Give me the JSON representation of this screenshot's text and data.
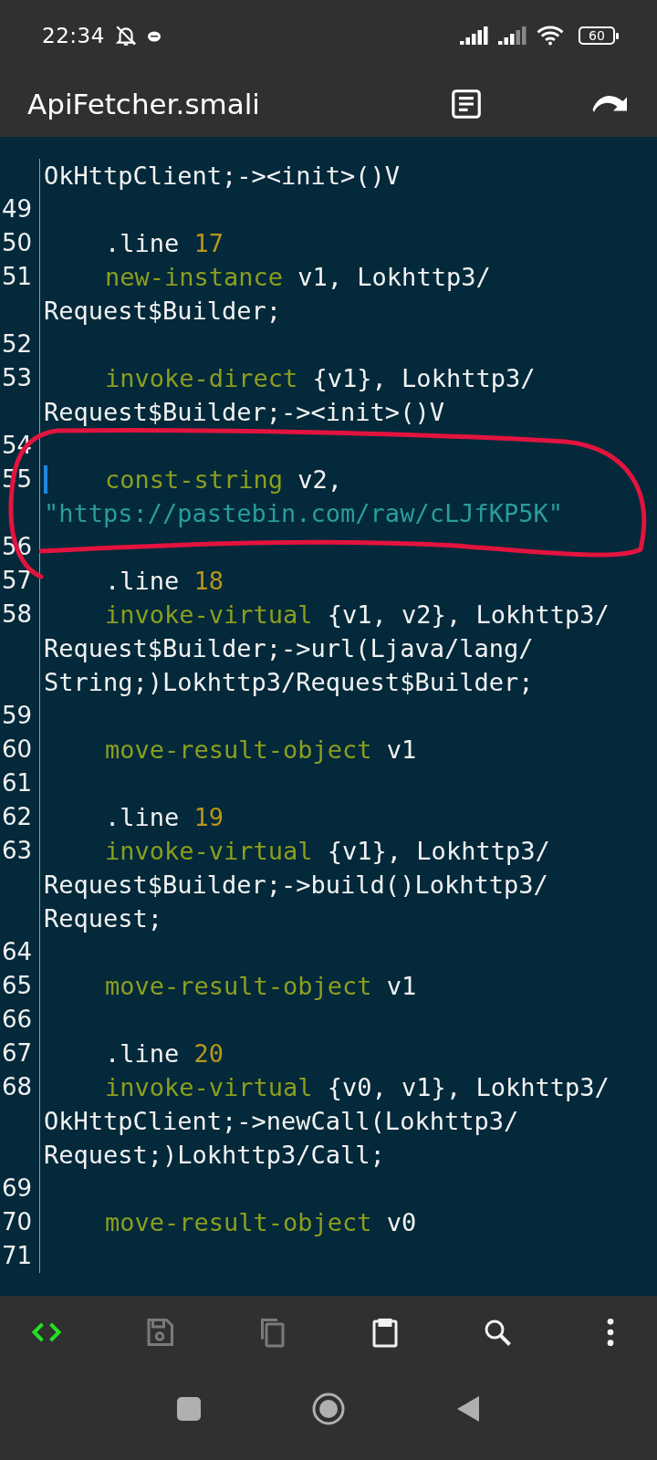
{
  "status_bar": {
    "time": "22:34",
    "battery": "60"
  },
  "app_bar": {
    "title": "ApiFetcher.smali"
  },
  "editor": {
    "lines": [
      {
        "continuation": true,
        "cursor": false,
        "rows": [
          [
            {
              "kind": "plain",
              "text": "OkHttpClient;-><init>()V"
            }
          ]
        ]
      },
      {
        "number": "49",
        "cursor": false
      },
      {
        "number": "50",
        "cursor": false,
        "rows": [
          [
            {
              "kind": "plain",
              "text": ".line "
            },
            {
              "kind": "number",
              "text": "17"
            }
          ]
        ]
      },
      {
        "number": "51",
        "cursor": false,
        "rows": [
          [
            {
              "kind": "keyword",
              "text": "new-instance"
            },
            {
              "kind": "plain",
              "text": " v1, Lokhttp3/"
            }
          ],
          [
            {
              "kind": "plain",
              "text": "Request$Builder;"
            }
          ]
        ]
      },
      {
        "number": "52",
        "cursor": false
      },
      {
        "number": "53",
        "cursor": false,
        "rows": [
          [
            {
              "kind": "keyword",
              "text": "invoke-direct"
            },
            {
              "kind": "plain",
              "text": " {v1}, Lokhttp3/"
            }
          ],
          [
            {
              "kind": "plain",
              "text": "Request$Builder;-><init>()V"
            }
          ]
        ]
      },
      {
        "number": "54",
        "cursor": false
      },
      {
        "number": "55",
        "cursor": true,
        "rows": [
          [
            {
              "kind": "keyword",
              "text": "const-string"
            },
            {
              "kind": "plain",
              "text": " v2,"
            }
          ],
          [
            {
              "kind": "string",
              "text": "\"https://pastebin.com/raw/cLJfKP5K\""
            }
          ]
        ]
      },
      {
        "number": "56",
        "cursor": false
      },
      {
        "number": "57",
        "cursor": false,
        "rows": [
          [
            {
              "kind": "plain",
              "text": ".line "
            },
            {
              "kind": "number",
              "text": "18"
            }
          ]
        ]
      },
      {
        "number": "58",
        "cursor": false,
        "rows": [
          [
            {
              "kind": "keyword",
              "text": "invoke-virtual"
            },
            {
              "kind": "plain",
              "text": " {v1, v2}, Lokhttp3/"
            }
          ],
          [
            {
              "kind": "plain",
              "text": "Request$Builder;->url(Ljava/lang/"
            }
          ],
          [
            {
              "kind": "plain",
              "text": "String;)Lokhttp3/Request$Builder;"
            }
          ]
        ]
      },
      {
        "number": "59",
        "cursor": false
      },
      {
        "number": "60",
        "cursor": false,
        "rows": [
          [
            {
              "kind": "keyword",
              "text": "move-result-object"
            },
            {
              "kind": "plain",
              "text": " v1"
            }
          ]
        ]
      },
      {
        "number": "61",
        "cursor": false
      },
      {
        "number": "62",
        "cursor": false,
        "rows": [
          [
            {
              "kind": "plain",
              "text": ".line "
            },
            {
              "kind": "number",
              "text": "19"
            }
          ]
        ]
      },
      {
        "number": "63",
        "cursor": false,
        "rows": [
          [
            {
              "kind": "keyword",
              "text": "invoke-virtual"
            },
            {
              "kind": "plain",
              "text": " {v1}, Lokhttp3/"
            }
          ],
          [
            {
              "kind": "plain",
              "text": "Request$Builder;->build()Lokhttp3/"
            }
          ],
          [
            {
              "kind": "plain",
              "text": "Request;"
            }
          ]
        ]
      },
      {
        "number": "64",
        "cursor": false
      },
      {
        "number": "65",
        "cursor": false,
        "rows": [
          [
            {
              "kind": "keyword",
              "text": "move-result-object"
            },
            {
              "kind": "plain",
              "text": " v1"
            }
          ]
        ]
      },
      {
        "number": "66",
        "cursor": false
      },
      {
        "number": "67",
        "cursor": false,
        "rows": [
          [
            {
              "kind": "plain",
              "text": ".line "
            },
            {
              "kind": "number",
              "text": "20"
            }
          ]
        ]
      },
      {
        "number": "68",
        "cursor": false,
        "rows": [
          [
            {
              "kind": "keyword",
              "text": "invoke-virtual"
            },
            {
              "kind": "plain",
              "text": " {v0, v1}, Lokhttp3/"
            }
          ],
          [
            {
              "kind": "plain",
              "text": "OkHttpClient;->newCall(Lokhttp3/"
            }
          ],
          [
            {
              "kind": "plain",
              "text": "Request;)Lokhttp3/Call;"
            }
          ]
        ]
      },
      {
        "number": "69",
        "cursor": false
      },
      {
        "number": "70",
        "cursor": false,
        "rows": [
          [
            {
              "kind": "keyword",
              "text": "move-result-object"
            },
            {
              "kind": "plain",
              "text": " v0"
            }
          ]
        ]
      },
      {
        "number": "71",
        "cursor": false
      }
    ]
  },
  "annotation": {
    "kind": "freehand-loop"
  },
  "toolbar": [
    {
      "kind": "code",
      "active": true,
      "disabled": false
    },
    {
      "kind": "save",
      "active": false,
      "disabled": true
    },
    {
      "kind": "copy",
      "active": false,
      "disabled": true
    },
    {
      "kind": "paste",
      "active": false,
      "disabled": false
    },
    {
      "kind": "search",
      "active": false,
      "disabled": false
    },
    {
      "kind": "more",
      "active": false,
      "disabled": false
    }
  ],
  "nav_bar": [
    {
      "kind": "recents"
    },
    {
      "kind": "home"
    },
    {
      "kind": "back"
    }
  ]
}
